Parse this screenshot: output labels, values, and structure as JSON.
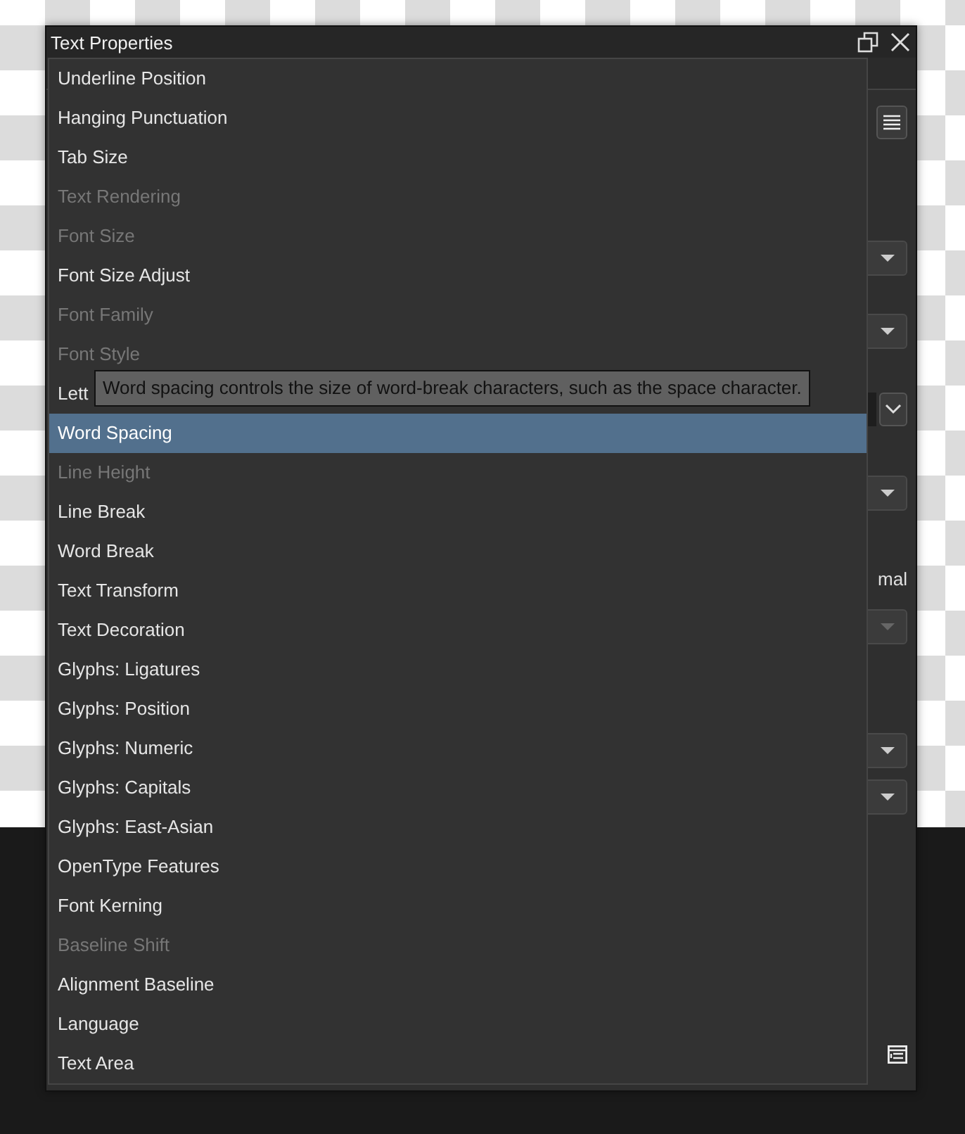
{
  "window": {
    "title": "Text Properties"
  },
  "background_controls": [
    {
      "kind": "icon-button"
    },
    {
      "kind": "dropdown",
      "disabled": false
    },
    {
      "kind": "dropdown",
      "disabled": false
    },
    {
      "kind": "combo"
    },
    {
      "kind": "dropdown",
      "disabled": false
    },
    {
      "kind": "text",
      "label": "mal"
    },
    {
      "kind": "dropdown",
      "disabled": true
    },
    {
      "kind": "dropdown",
      "disabled": false
    },
    {
      "kind": "dropdown",
      "disabled": false
    },
    {
      "kind": "panel-icon"
    }
  ],
  "menu": {
    "items": [
      {
        "label": "Underline Position",
        "disabled": false,
        "selected": false
      },
      {
        "label": "Hanging Punctuation",
        "disabled": false,
        "selected": false
      },
      {
        "label": "Tab Size",
        "disabled": false,
        "selected": false
      },
      {
        "label": "Text Rendering",
        "disabled": true,
        "selected": false
      },
      {
        "label": "Font Size",
        "disabled": true,
        "selected": false
      },
      {
        "label": "Font Size Adjust",
        "disabled": false,
        "selected": false
      },
      {
        "label": "Font Family",
        "disabled": true,
        "selected": false
      },
      {
        "label": "Font Style",
        "disabled": true,
        "selected": false
      },
      {
        "label": "Lett",
        "disabled": false,
        "selected": false
      },
      {
        "label": "Word Spacing",
        "disabled": false,
        "selected": true
      },
      {
        "label": "Line Height",
        "disabled": true,
        "selected": false
      },
      {
        "label": "Line Break",
        "disabled": false,
        "selected": false
      },
      {
        "label": "Word Break",
        "disabled": false,
        "selected": false
      },
      {
        "label": "Text Transform",
        "disabled": false,
        "selected": false
      },
      {
        "label": "Text Decoration",
        "disabled": false,
        "selected": false
      },
      {
        "label": "Glyphs: Ligatures",
        "disabled": false,
        "selected": false
      },
      {
        "label": "Glyphs: Position",
        "disabled": false,
        "selected": false
      },
      {
        "label": "Glyphs: Numeric",
        "disabled": false,
        "selected": false
      },
      {
        "label": "Glyphs: Capitals",
        "disabled": false,
        "selected": false
      },
      {
        "label": "Glyphs: East-Asian",
        "disabled": false,
        "selected": false
      },
      {
        "label": "OpenType Features",
        "disabled": false,
        "selected": false
      },
      {
        "label": "Font Kerning",
        "disabled": false,
        "selected": false
      },
      {
        "label": "Baseline Shift",
        "disabled": true,
        "selected": false
      },
      {
        "label": "Alignment Baseline",
        "disabled": false,
        "selected": false
      },
      {
        "label": "Language",
        "disabled": false,
        "selected": false
      },
      {
        "label": "Text Area",
        "disabled": false,
        "selected": false
      }
    ]
  },
  "tooltip": "Word spacing controls the size of word-break characters, such as the space character."
}
